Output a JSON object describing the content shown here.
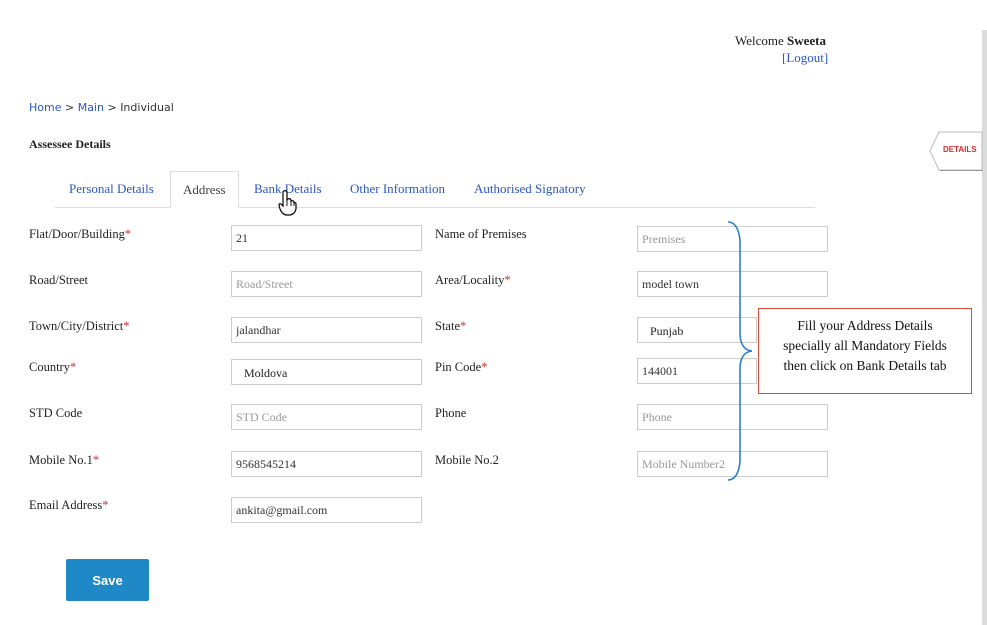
{
  "header": {
    "welcome_text": "Welcome",
    "user_name": "Sweeta",
    "logout_label": "[Logout]"
  },
  "breadcrumb": {
    "home": "Home",
    "sep1": " > ",
    "main": "Main",
    "sep2": " > ",
    "current": "Individual"
  },
  "section_title": "Assessee Details",
  "tabs": [
    "Personal Details",
    "Address",
    "Bank Details",
    "Other Information",
    "Authorised Signatory"
  ],
  "active_tab": "Address",
  "side_tab_label": "DETAILS",
  "required_marker": "*",
  "fields": {
    "flat": {
      "label": "Flat/Door/Building",
      "value": "21",
      "placeholder": ""
    },
    "premises": {
      "label": "Name of Premises",
      "value": "",
      "placeholder": "Premises"
    },
    "road": {
      "label": "Road/Street",
      "value": "",
      "placeholder": "Road/Street"
    },
    "area": {
      "label": "Area/Locality",
      "value": "model town",
      "placeholder": ""
    },
    "town": {
      "label": "Town/City/District",
      "value": "jalandhar",
      "placeholder": ""
    },
    "state": {
      "label": "State",
      "value": "Punjab"
    },
    "country": {
      "label": "Country",
      "value": "Moldova"
    },
    "pin": {
      "label": "Pin Code",
      "value": "144001",
      "placeholder": ""
    },
    "std": {
      "label": "STD Code",
      "value": "",
      "placeholder": "STD Code"
    },
    "phone": {
      "label": "Phone",
      "value": "",
      "placeholder": "Phone"
    },
    "mobile1": {
      "label": "Mobile No.1",
      "value": "9568545214",
      "placeholder": ""
    },
    "mobile2": {
      "label": "Mobile No.2",
      "value": "",
      "placeholder": "Mobile Number2"
    },
    "email": {
      "label": "Email Address",
      "value": "ankita@gmail.com",
      "placeholder": ""
    }
  },
  "callout": {
    "line1": "Fill your Address Details",
    "line2": "specially all Mandatory Fields",
    "line3": "then click on Bank Details tab"
  },
  "save_label": "Save",
  "colors": {
    "link": "#2a56c6",
    "required": "#d32f2f",
    "save_button": "#1f88c6",
    "callout_border": "#d84a3a",
    "brace": "#2a7fd0"
  }
}
